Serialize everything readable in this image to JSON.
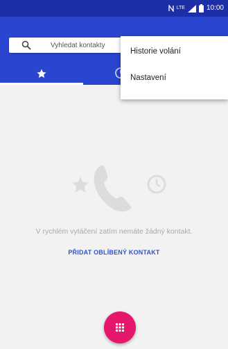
{
  "status_bar": {
    "network_label": "LTE",
    "time": "10:00"
  },
  "search": {
    "placeholder": "Vyhledat kontakty"
  },
  "tabs": [
    {
      "icon": "star-icon"
    },
    {
      "icon": "clock-icon"
    }
  ],
  "overflow_menu": {
    "items": [
      {
        "label": "Historie volání"
      },
      {
        "label": "Nastavení"
      }
    ]
  },
  "empty_state": {
    "message": "V rychlém vytáčení zatím nemáte žádný kontakt.",
    "action_label": "PŘIDAT OBLÍBENÝ KONTAKT"
  },
  "fab": {
    "icon": "dialpad-icon"
  },
  "colors": {
    "status_bar": "#1d2fa6",
    "app_bar": "#2a45cf",
    "background": "#f2f2f2",
    "accent_link": "#3052cf",
    "fab": "#e5176a"
  }
}
